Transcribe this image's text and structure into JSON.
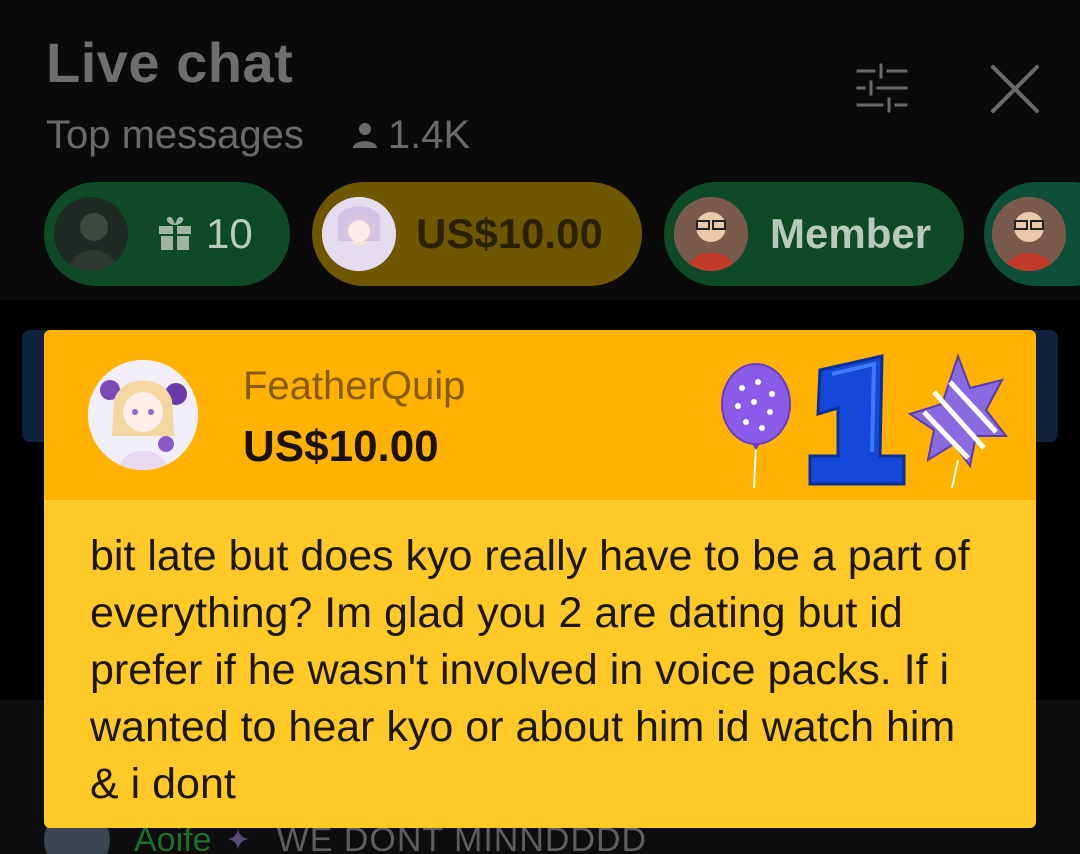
{
  "header": {
    "title": "Live chat",
    "subtitle": "Top messages",
    "viewer_count": "1.4K",
    "filter_icon": "sliders-icon",
    "close_icon": "close-icon"
  },
  "ticker": {
    "chips": [
      {
        "kind": "gift",
        "value": "10",
        "icon": "gift-icon"
      },
      {
        "kind": "superchat",
        "value": "US$10.00"
      },
      {
        "kind": "member",
        "value": "Member"
      },
      {
        "kind": "partial",
        "value": ""
      }
    ]
  },
  "superchat": {
    "author": "FeatherQuip",
    "amount": "US$10.00",
    "message": "bit late but does kyo really have to be a part of everything? Im glad you 2 are dating but id prefer if he wasn't involved in voice packs. If i wanted to hear kyo or about him id watch him & i dont",
    "sticker": "balloons-number-one-sticker"
  },
  "background_message": {
    "author": "Aoife",
    "text": "WE DONT MINNDDDD"
  },
  "colors": {
    "background": "#000000",
    "superchat_header": "#ffb300",
    "superchat_body": "#ffca28",
    "chip_green": "#0e4a26",
    "chip_gold": "#6f5700",
    "pinned_blue": "#10223c"
  }
}
